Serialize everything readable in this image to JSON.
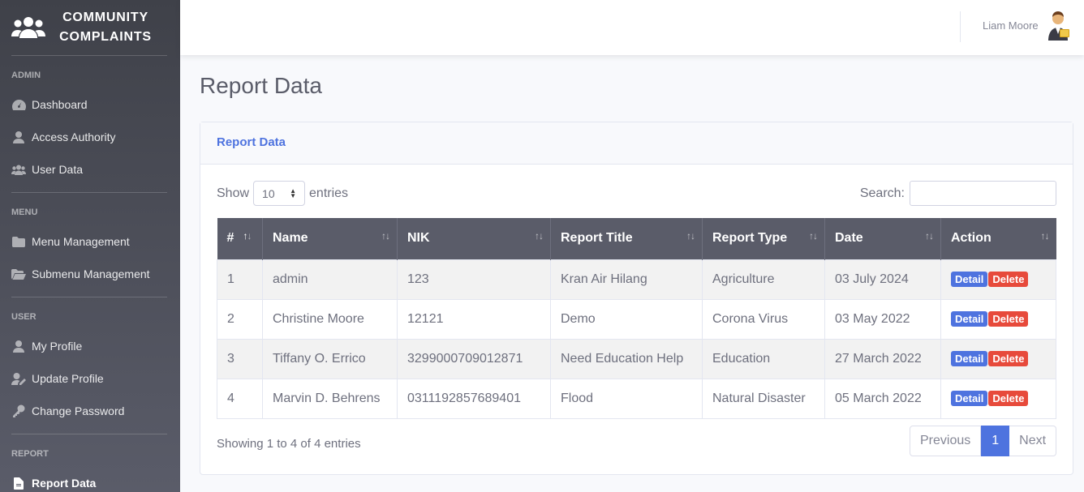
{
  "brand": {
    "line1": "COMMUNITY",
    "line2": "COMPLAINTS"
  },
  "sidebar": {
    "sections": [
      {
        "heading": "ADMIN",
        "items": [
          {
            "label": "Dashboard",
            "icon": "dashboard-icon"
          },
          {
            "label": "Access Authority",
            "icon": "user-icon"
          },
          {
            "label": "User Data",
            "icon": "users-icon"
          }
        ]
      },
      {
        "heading": "MENU",
        "items": [
          {
            "label": "Menu Management",
            "icon": "folder-icon"
          },
          {
            "label": "Submenu Management",
            "icon": "folder-open-icon"
          }
        ]
      },
      {
        "heading": "USER",
        "items": [
          {
            "label": "My Profile",
            "icon": "user-icon"
          },
          {
            "label": "Update Profile",
            "icon": "user-edit-icon"
          },
          {
            "label": "Change Password",
            "icon": "key-icon"
          }
        ]
      },
      {
        "heading": "REPORT",
        "items": [
          {
            "label": "Report Data",
            "icon": "file-icon",
            "active": true
          }
        ]
      }
    ]
  },
  "topbar": {
    "user_name": "Liam Moore"
  },
  "page": {
    "title": "Report Data"
  },
  "card": {
    "header": "Report Data"
  },
  "controls": {
    "show": "Show",
    "entries_value": "10",
    "entries": "entries",
    "search_label": "Search:"
  },
  "table": {
    "headers": [
      "#",
      "Name",
      "NIK",
      "Report Title",
      "Report Type",
      "Date",
      "Action"
    ],
    "rows": [
      [
        "1",
        "admin",
        "123",
        "Kran Air Hilang",
        "Agriculture",
        "03 July 2024"
      ],
      [
        "2",
        "Christine Moore",
        "12121",
        "Demo",
        "Corona Virus",
        "03 May 2022"
      ],
      [
        "3",
        "Tiffany O. Errico",
        "3299000709012871",
        "Need Education Help",
        "Education",
        "27 March 2022"
      ],
      [
        "4",
        "Marvin D. Behrens",
        "0311192857689401",
        "Flood",
        "Natural Disaster",
        "05 March 2022"
      ]
    ],
    "detail_label": "Detail",
    "delete_label": "Delete"
  },
  "footer": {
    "info": "Showing 1 to 4 of 4 entries",
    "previous": "Previous",
    "page": "1",
    "next": "Next"
  }
}
